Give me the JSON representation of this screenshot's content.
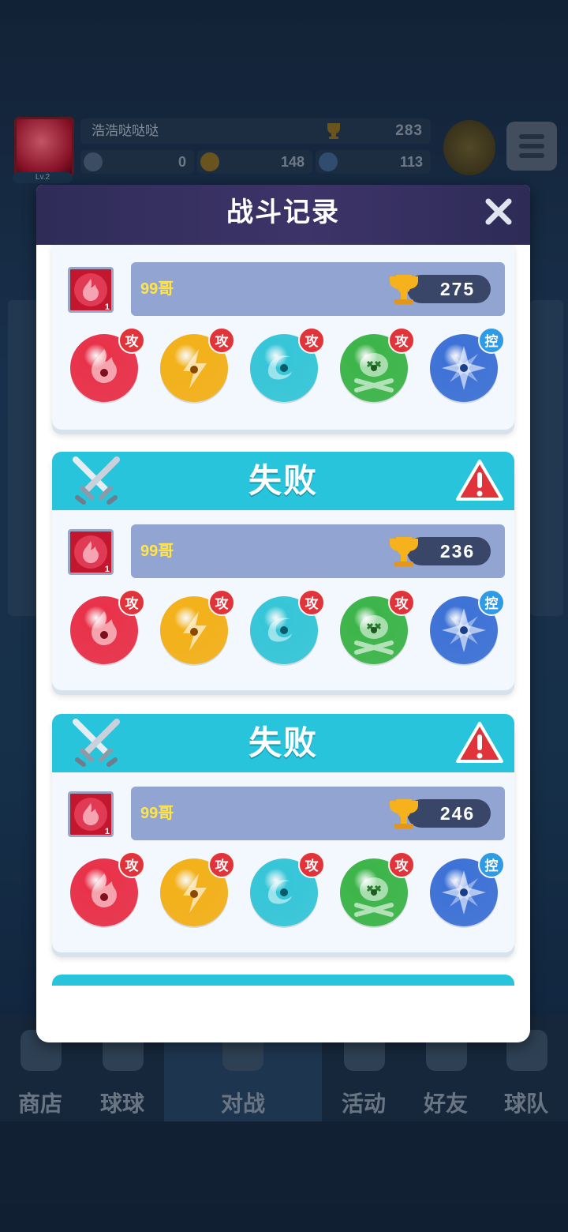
{
  "player": {
    "name": "浩浩哒哒哒",
    "level": "Lv.2",
    "trophies": "283",
    "resource_1": "0",
    "resource_2": "148",
    "resource_3": "113"
  },
  "nav": [
    {
      "label": "商店"
    },
    {
      "label": "球球"
    },
    {
      "label": "对战"
    },
    {
      "label": "活动"
    },
    {
      "label": "好友"
    },
    {
      "label": "球队"
    }
  ],
  "dialog": {
    "title": "战斗记录",
    "close_icon": "close-icon",
    "records": [
      {
        "result": "",
        "opponent": "99哥",
        "avatar_level": "1",
        "trophies": "275",
        "balls": [
          {
            "type": "fire",
            "badge": "攻",
            "color": "#e8324a"
          },
          {
            "type": "lightning",
            "badge": "攻",
            "color": "#f3b11a"
          },
          {
            "type": "wind",
            "badge": "攻",
            "color": "#36c6d8"
          },
          {
            "type": "poison",
            "badge": "攻",
            "color": "#3db54a"
          },
          {
            "type": "ice",
            "badge": "控",
            "color": "#3e72d6"
          }
        ]
      },
      {
        "result": "失败",
        "opponent": "99哥",
        "avatar_level": "1",
        "trophies": "236",
        "balls": [
          {
            "type": "fire",
            "badge": "攻",
            "color": "#e8324a"
          },
          {
            "type": "lightning",
            "badge": "攻",
            "color": "#f3b11a"
          },
          {
            "type": "wind",
            "badge": "攻",
            "color": "#36c6d8"
          },
          {
            "type": "poison",
            "badge": "攻",
            "color": "#3db54a"
          },
          {
            "type": "ice",
            "badge": "控",
            "color": "#3e72d6"
          }
        ]
      },
      {
        "result": "失败",
        "opponent": "99哥",
        "avatar_level": "1",
        "trophies": "246",
        "balls": [
          {
            "type": "fire",
            "badge": "攻",
            "color": "#e8324a"
          },
          {
            "type": "lightning",
            "badge": "攻",
            "color": "#f3b11a"
          },
          {
            "type": "wind",
            "badge": "攻",
            "color": "#36c6d8"
          },
          {
            "type": "poison",
            "badge": "攻",
            "color": "#3db54a"
          },
          {
            "type": "ice",
            "badge": "控",
            "color": "#3e72d6"
          }
        ]
      }
    ]
  },
  "colors": {
    "header_bg": "#2f2c58",
    "result_bar": "#27c4dc",
    "player_bar": "#92a4d2",
    "name_text": "#ffe44a",
    "attack_badge": "#e0343a",
    "control_badge": "#2f9be6"
  }
}
